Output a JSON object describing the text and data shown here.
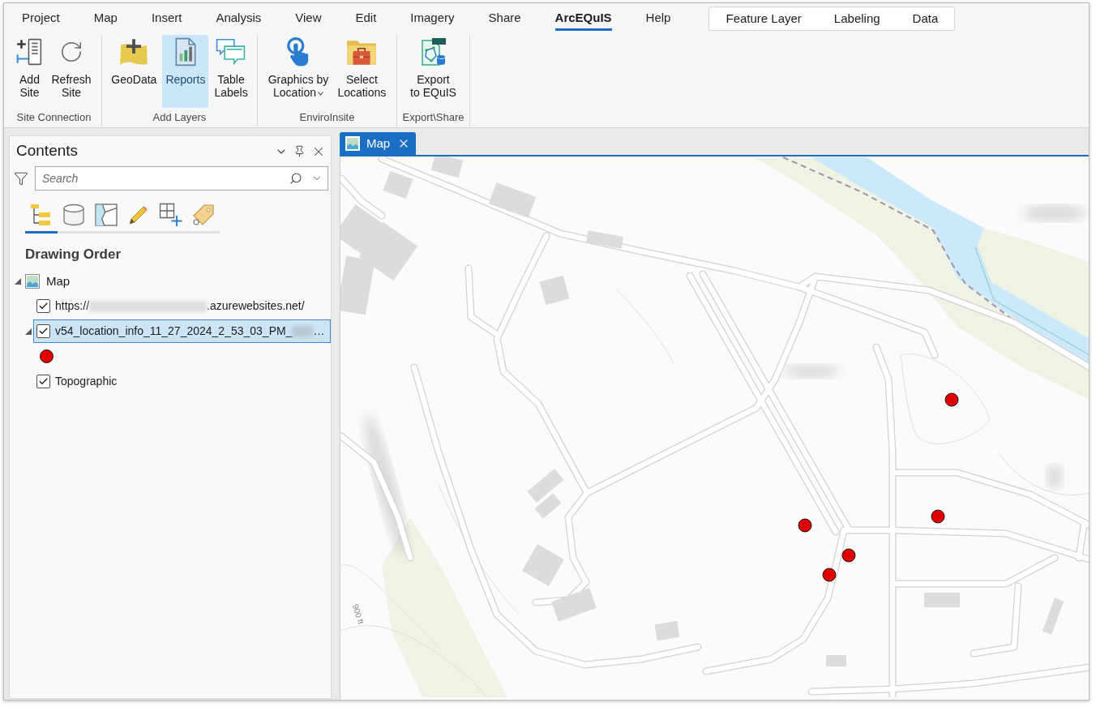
{
  "ribbon": {
    "tabs": [
      {
        "label": "Project",
        "selected": false
      },
      {
        "label": "Map",
        "selected": false
      },
      {
        "label": "Insert",
        "selected": false
      },
      {
        "label": "Analysis",
        "selected": false
      },
      {
        "label": "View",
        "selected": false
      },
      {
        "label": "Edit",
        "selected": false
      },
      {
        "label": "Imagery",
        "selected": false
      },
      {
        "label": "Share",
        "selected": false
      },
      {
        "label": "ArcEQuIS",
        "selected": true
      },
      {
        "label": "Help",
        "selected": false
      }
    ],
    "contextual_tabs": [
      {
        "label": "Feature Layer",
        "selected": false
      },
      {
        "label": "Labeling",
        "selected": false
      },
      {
        "label": "Data",
        "selected": false
      }
    ],
    "groups": [
      {
        "label": "Site Connection",
        "buttons": [
          {
            "label": "Add\nSite",
            "highlighted": false,
            "dropdown": false
          },
          {
            "label": "Refresh\nSite",
            "highlighted": false,
            "dropdown": false
          }
        ]
      },
      {
        "label": "Add Layers",
        "buttons": [
          {
            "label": "GeoData",
            "highlighted": false,
            "dropdown": false
          },
          {
            "label": "Reports",
            "highlighted": true,
            "dropdown": false
          },
          {
            "label": "Table\nLabels",
            "highlighted": false,
            "dropdown": false
          }
        ]
      },
      {
        "label": "EnviroInsite",
        "buttons": [
          {
            "label": "Graphics by\nLocation",
            "highlighted": false,
            "dropdown": true
          },
          {
            "label": "Select\nLocations",
            "highlighted": false,
            "dropdown": false
          }
        ]
      },
      {
        "label": "Export\\Share",
        "buttons": [
          {
            "label": "Export\nto EQuIS",
            "highlighted": false,
            "dropdown": false
          }
        ]
      }
    ]
  },
  "contents": {
    "title": "Contents",
    "search": {
      "placeholder": "Search"
    },
    "view_tabs": [
      {
        "selected": true
      },
      {
        "selected": false
      },
      {
        "selected": false
      },
      {
        "selected": false
      },
      {
        "selected": false
      },
      {
        "selected": false
      }
    ],
    "heading": "Drawing Order",
    "tree": [
      {
        "label": "Map",
        "expanded": true,
        "children": [
          {
            "kind": "layer",
            "label_parts": [
              {
                "kind": "text",
                "text": "https://"
              },
              {
                "kind": "redacted"
              },
              {
                "kind": "text",
                "text": ".azurewebsites.net/"
              }
            ],
            "checked": true,
            "selected": false
          },
          {
            "kind": "feature_layer",
            "label_parts": [
              {
                "kind": "text",
                "text": "v54_location_info_11_27_2024_2_53_03_PM_"
              },
              {
                "kind": "redacted"
              },
              {
                "kind": "text",
                "text": "…"
              }
            ],
            "checked": true,
            "selected": true,
            "expanded": true
          },
          {
            "kind": "layer",
            "label_parts": [
              {
                "kind": "text",
                "text": "Topographic"
              }
            ],
            "checked": true,
            "selected": false
          }
        ]
      }
    ]
  },
  "map_view": {
    "tabs": [
      {
        "label": "Map",
        "selected": true
      }
    ],
    "labels": [
      "900 ft"
    ]
  }
}
